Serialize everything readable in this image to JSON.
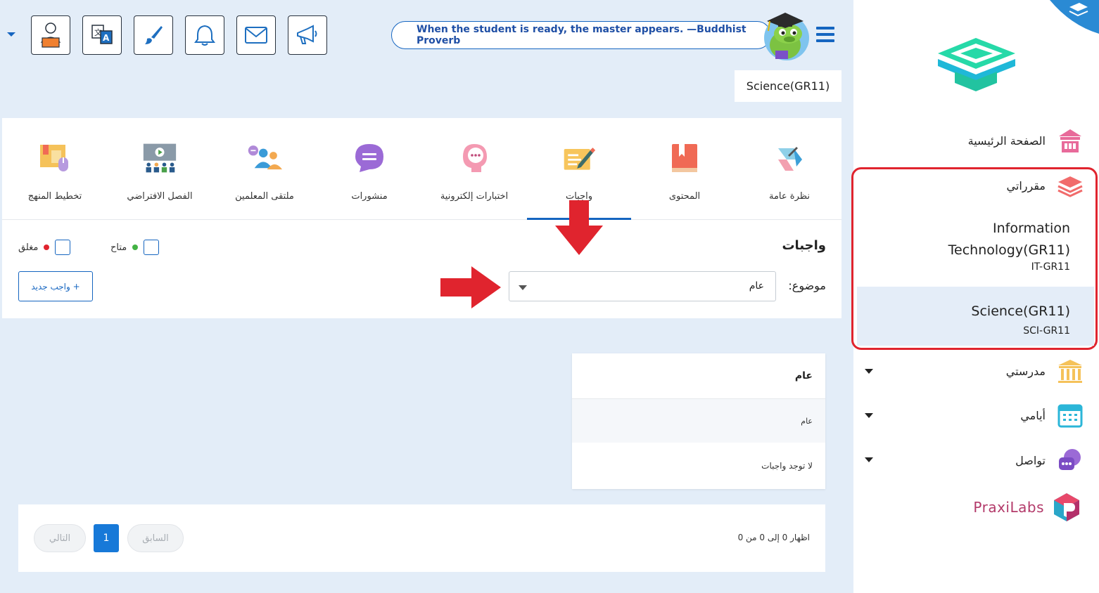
{
  "header": {
    "quote": "When the student is ready, the master appears. —Buddhist Proverb",
    "course_label": "Science(GR11)",
    "toolbar": [
      "profile-icon",
      "translate-icon",
      "brush-icon",
      "bell-icon",
      "mail-icon",
      "megaphone-icon"
    ]
  },
  "tabs": [
    {
      "label": "نظرة عامة",
      "icon": "overview-icon"
    },
    {
      "label": "المحتوى",
      "icon": "book-icon"
    },
    {
      "label": "واجبات",
      "icon": "homework-icon"
    },
    {
      "label": "اختبارات إلكترونية",
      "icon": "quiz-icon"
    },
    {
      "label": "منشورات",
      "icon": "posts-icon"
    },
    {
      "label": "ملتقى المعلمين",
      "icon": "teachers-forum-icon"
    },
    {
      "label": "الفصل الافتراضي",
      "icon": "virtual-class-icon"
    },
    {
      "label": "تخطيط المنهج",
      "icon": "curriculum-icon"
    }
  ],
  "filters": {
    "title": "واجبات",
    "legend_available": "متاح",
    "legend_closed": "مغلق",
    "new_button": "+ واجب جديد",
    "subject_label": "موضوع:",
    "subject_value": "عام"
  },
  "card": {
    "header": "عام",
    "row_subject": "عام",
    "empty_text": "لا توجد واجبات"
  },
  "pager": {
    "info": "اظهار 0 إلى 0 من 0",
    "prev": "السابق",
    "current": "1",
    "next": "التالي"
  },
  "sidebar": {
    "home": "الصفحة الرئيسية",
    "my_courses": "مقرراتي",
    "courses": [
      {
        "name_line1": "Information",
        "name_line2": "Technology(GR11)",
        "code": "IT-GR11"
      },
      {
        "name": "Science(GR11)",
        "code": "SCI-GR11"
      }
    ],
    "my_school": "مدرستي",
    "my_days": "أيامي",
    "communication": "تواصل",
    "praxilabs": "PraxiLabs"
  },
  "colors": {
    "accent": "#1565c0",
    "highlight_red": "#e0242e",
    "page_bg": "#e3edf8",
    "available_dot": "#43b244",
    "closed_dot": "#e0242e"
  }
}
